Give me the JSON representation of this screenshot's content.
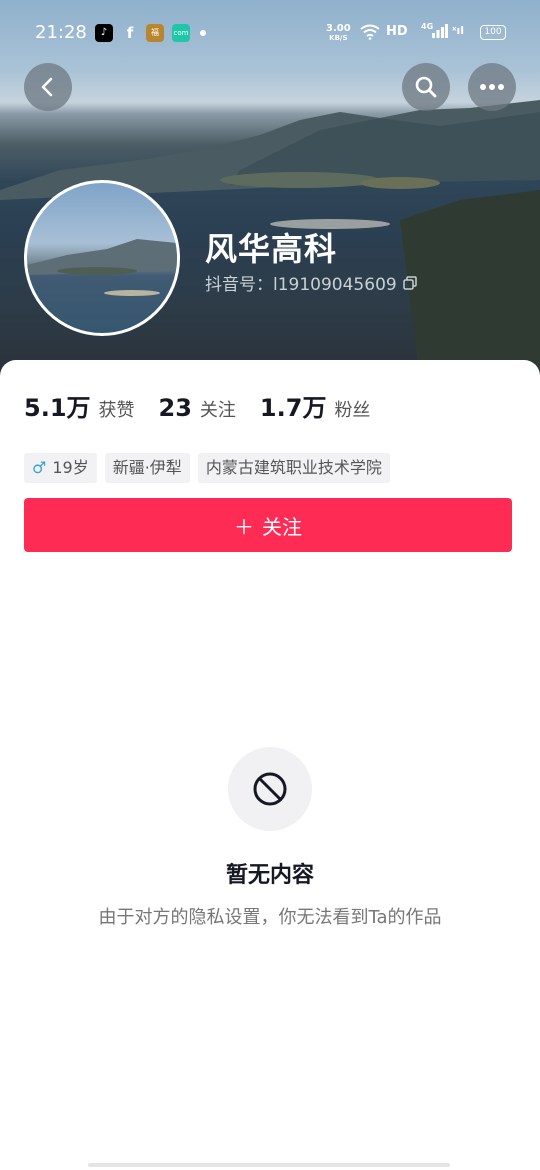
{
  "status_bar": {
    "time": "21:28",
    "apps": [
      "tiktok-icon",
      "facebook-icon",
      "news-app-icon",
      "com-app-icon"
    ],
    "net_speed_value": "3.00",
    "net_speed_unit": "KB/S",
    "wifi": "wifi-icon",
    "hd": "HD",
    "signal_label": "4G",
    "battery": "100"
  },
  "profile": {
    "name": "风华高科",
    "douyin_id": "抖音号：l19109045609"
  },
  "stats": [
    {
      "num": "5.1万",
      "label": "获赞"
    },
    {
      "num": "23",
      "label": "关注"
    },
    {
      "num": "1.7万",
      "label": "粉丝"
    }
  ],
  "tags": {
    "gender_symbol": "♂",
    "age": "19岁",
    "location": "新疆·伊犁",
    "school": "内蒙古建筑职业技术学院"
  },
  "follow_button": {
    "icon": "＋",
    "label": "关注"
  },
  "empty_state": {
    "title": "暂无内容",
    "description": "由于对方的隐私设置，你无法看到Ta的作品"
  },
  "colors": {
    "accent": "#fe2c55",
    "text_primary": "#161823",
    "tag_bg": "#f2f2f4"
  }
}
